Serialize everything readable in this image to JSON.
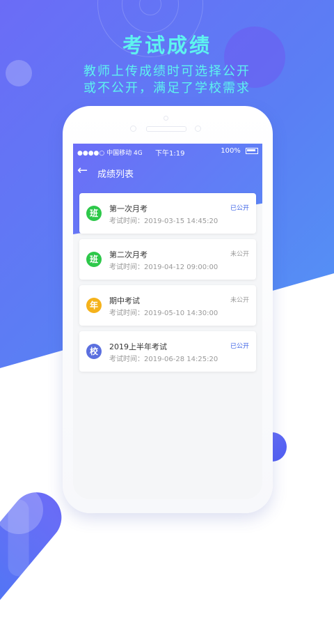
{
  "promo": {
    "headline": "考试成绩",
    "line1": "教师上传成绩时可选择公开",
    "line2": "或不公开，满足了学校需求"
  },
  "status_bar": {
    "carrier": "●●●●○ 中国移动 4G",
    "time": "下午1:19",
    "battery": "100%"
  },
  "nav": {
    "back_icon": "arrow-left-icon",
    "title": "成绩列表"
  },
  "colors": {
    "green": "#2dc84a",
    "yellow": "#f5b21b",
    "blue": "#5b6fdf",
    "public_blue": "#3d63e6",
    "private_gray": "#999999"
  },
  "exams": [
    {
      "avatar": "班",
      "title": "第一次月考",
      "time": "考试时间：2019-03-15  14:45:20",
      "status": "已公开"
    },
    {
      "avatar": "班",
      "title": "第二次月考",
      "time": "考试时间：2019-04-12  09:00:00",
      "status": "未公开"
    },
    {
      "avatar": "年",
      "title": "期中考试",
      "time": "考试时间：2019-05-10  14:30:00",
      "status": "未公开"
    },
    {
      "avatar": "校",
      "title": "2019上半年考试",
      "time": "考试时间：2019-06-28  14:25:20",
      "status": "已公开"
    }
  ]
}
